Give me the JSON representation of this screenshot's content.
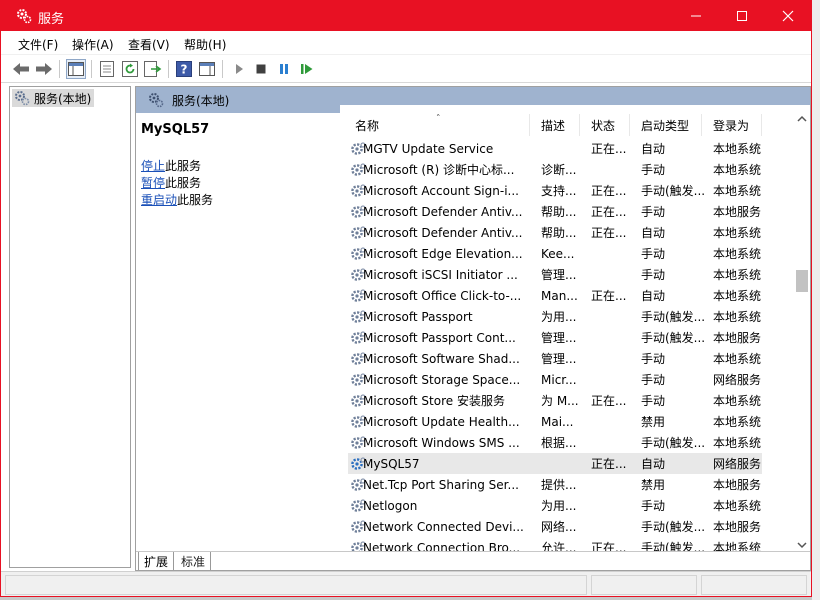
{
  "window": {
    "title": "服务",
    "accent": "#e81123"
  },
  "menu": [
    {
      "label": "文件(F)"
    },
    {
      "label": "操作(A)"
    },
    {
      "label": "查看(V)"
    },
    {
      "label": "帮助(H)"
    }
  ],
  "toolbar": {
    "icons": [
      "back-icon",
      "forward-icon",
      "show-hide-tree-icon",
      "properties-icon",
      "refresh-icon",
      "export-list-icon",
      "help-icon",
      "show-hide-action-pane-icon",
      "start-service-icon",
      "stop-service-icon",
      "pause-service-icon",
      "resume-service-icon"
    ]
  },
  "tree": {
    "root_label": "服务(本地)"
  },
  "pane": {
    "header": "服务(本地)",
    "selected_service": "MySQL57",
    "actions": [
      {
        "link": "停止",
        "suffix": "此服务"
      },
      {
        "link": "暂停",
        "suffix": "此服务"
      },
      {
        "link": "重启动",
        "suffix": "此服务"
      }
    ]
  },
  "columns": [
    "名称",
    "描述",
    "状态",
    "启动类型",
    "登录为"
  ],
  "services": [
    {
      "name": "MGTV Update Service",
      "desc": "",
      "status": "正在...",
      "startup": "自动",
      "logon": "本地系统"
    },
    {
      "name": "Microsoft (R) 诊断中心标...",
      "desc": "诊断...",
      "status": "",
      "startup": "手动",
      "logon": "本地系统"
    },
    {
      "name": "Microsoft Account Sign-i...",
      "desc": "支持...",
      "status": "正在...",
      "startup": "手动(触发...",
      "logon": "本地系统"
    },
    {
      "name": "Microsoft Defender Antiv...",
      "desc": "帮助...",
      "status": "正在...",
      "startup": "手动",
      "logon": "本地服务"
    },
    {
      "name": "Microsoft Defender Antiv...",
      "desc": "帮助...",
      "status": "正在...",
      "startup": "自动",
      "logon": "本地系统"
    },
    {
      "name": "Microsoft Edge Elevation...",
      "desc": "Kee...",
      "status": "",
      "startup": "手动",
      "logon": "本地系统"
    },
    {
      "name": "Microsoft iSCSI Initiator ...",
      "desc": "管理...",
      "status": "",
      "startup": "手动",
      "logon": "本地系统"
    },
    {
      "name": "Microsoft Office Click-to-...",
      "desc": "Man...",
      "status": "正在...",
      "startup": "自动",
      "logon": "本地系统"
    },
    {
      "name": "Microsoft Passport",
      "desc": "为用...",
      "status": "",
      "startup": "手动(触发...",
      "logon": "本地系统"
    },
    {
      "name": "Microsoft Passport Cont...",
      "desc": "管理...",
      "status": "",
      "startup": "手动(触发...",
      "logon": "本地服务"
    },
    {
      "name": "Microsoft Software Shad...",
      "desc": "管理...",
      "status": "",
      "startup": "手动",
      "logon": "本地系统"
    },
    {
      "name": "Microsoft Storage Space...",
      "desc": "Micr...",
      "status": "",
      "startup": "手动",
      "logon": "网络服务"
    },
    {
      "name": "Microsoft Store 安装服务",
      "desc": "为 M...",
      "status": "正在...",
      "startup": "手动",
      "logon": "本地系统"
    },
    {
      "name": "Microsoft Update Health...",
      "desc": "Mai...",
      "status": "",
      "startup": "禁用",
      "logon": "本地系统"
    },
    {
      "name": "Microsoft Windows SMS ...",
      "desc": "根据...",
      "status": "",
      "startup": "手动(触发...",
      "logon": "本地系统"
    },
    {
      "name": "MySQL57",
      "desc": "",
      "status": "正在...",
      "startup": "自动",
      "logon": "网络服务",
      "selected": true
    },
    {
      "name": "Net.Tcp Port Sharing Ser...",
      "desc": "提供...",
      "status": "",
      "startup": "禁用",
      "logon": "本地服务"
    },
    {
      "name": "Netlogon",
      "desc": "为用...",
      "status": "",
      "startup": "手动",
      "logon": "本地系统"
    },
    {
      "name": "Network Connected Devi...",
      "desc": "网络...",
      "status": "",
      "startup": "手动(触发...",
      "logon": "本地服务"
    },
    {
      "name": "Network Connection Bro...",
      "desc": "允许...",
      "status": "正在...",
      "startup": "手动(触发...",
      "logon": "本地系统"
    }
  ],
  "scroll": {
    "position": 0.37
  },
  "tabs": [
    "扩展",
    "标准"
  ]
}
